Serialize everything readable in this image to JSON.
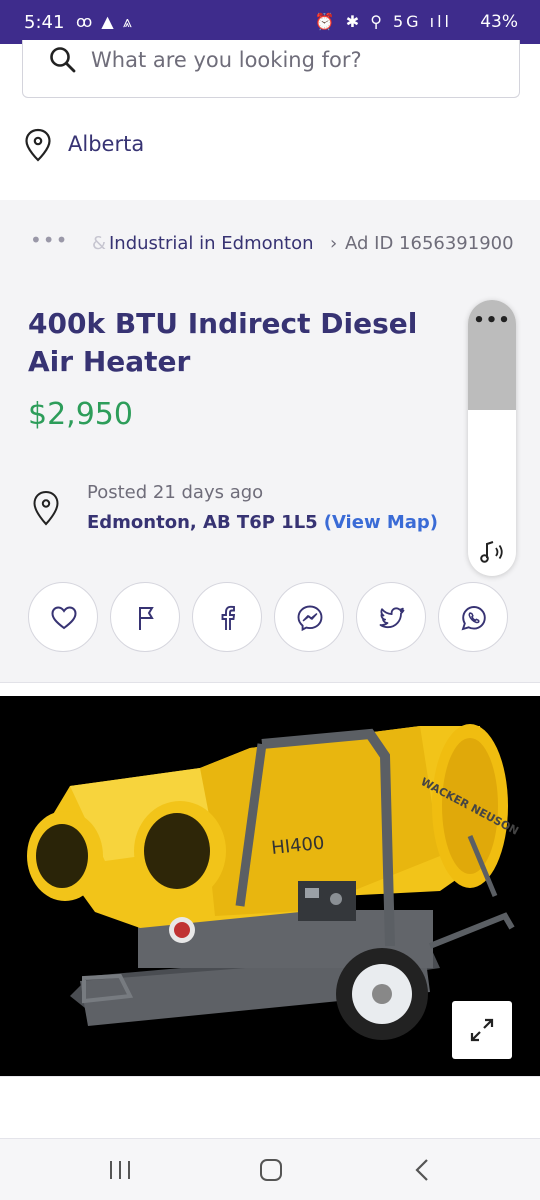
{
  "status_bar": {
    "time": "5:41",
    "left_icons": "ꝏ ▲ ⩓",
    "right_icons": "⏰ ✱ ⚲ 5G ıll",
    "battery": "43%"
  },
  "search": {
    "placeholder": "What are you looking for?",
    "location": "Alberta"
  },
  "breadcrumb": {
    "dots": "•••",
    "faded": "&",
    "category": "Industrial in Edmonton",
    "separator": "›",
    "ad_id": "Ad ID 1656391900"
  },
  "listing": {
    "title": "400k BTU Indirect Diesel Air Heater",
    "price": "$2,950",
    "posted": "Posted 21 days ago",
    "address": "Edmonton, AB T6P 1L5",
    "view_map": "(View Map)"
  },
  "side_panel": {
    "menu": "•••"
  },
  "share_buttons": [
    {
      "name": "favorite",
      "icon": "heart-icon"
    },
    {
      "name": "report",
      "icon": "flag-icon"
    },
    {
      "name": "facebook",
      "icon": "facebook-icon"
    },
    {
      "name": "messenger",
      "icon": "messenger-icon"
    },
    {
      "name": "twitter",
      "icon": "twitter-icon"
    },
    {
      "name": "whatsapp",
      "icon": "whatsapp-icon"
    }
  ],
  "photo": {
    "brand_text": "WACKER NEUSON",
    "model_text": "HI400"
  },
  "colors": {
    "status_bar": "#3e2c8c",
    "primary_text": "#373373",
    "price": "#2d9d5a",
    "link": "#3a6bd6",
    "heater_yellow": "#f2c419"
  }
}
